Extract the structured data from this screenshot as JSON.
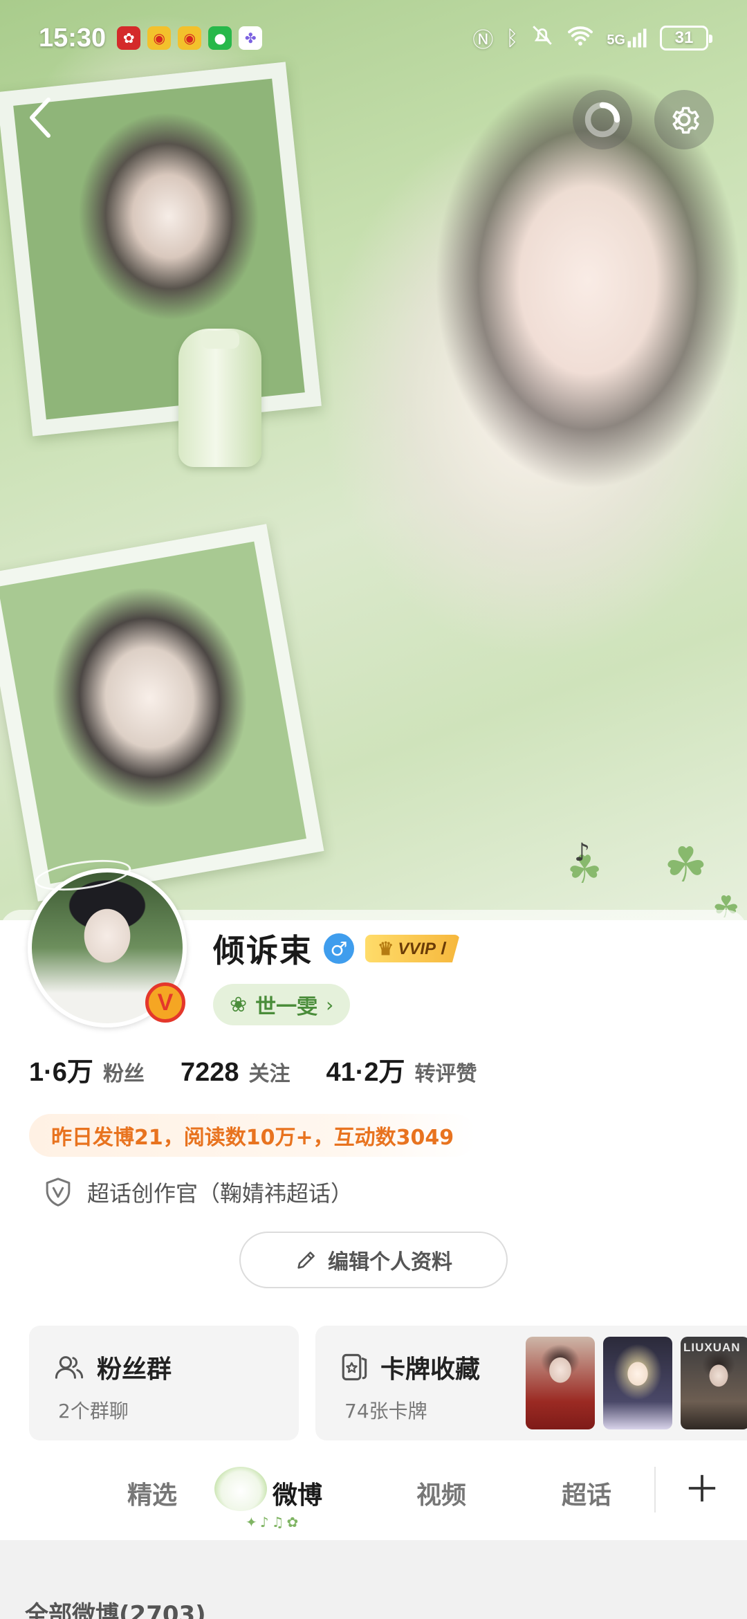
{
  "status_bar": {
    "time": "15:30",
    "network": "5G",
    "battery": "31",
    "notification_apps": [
      "huawei-app-icon",
      "weibo-icon",
      "weibo-icon",
      "wechat-icon",
      "gallery-icon"
    ],
    "system_icons": [
      "nfc-icon",
      "bluetooth-icon",
      "mute-icon",
      "wifi-icon",
      "signal-icon"
    ]
  },
  "profile": {
    "username": "倾诉束",
    "gender_symbol": "♂",
    "vip_label": "VVIP Ⅰ",
    "title_pill": "世一雯",
    "verified_badge": "V",
    "stats": [
      {
        "value": "1·6万",
        "label": "粉丝"
      },
      {
        "value": "7228",
        "label": "关注"
      },
      {
        "value": "41·2万",
        "label": "转评赞"
      }
    ],
    "highlight": "昨日发博21，阅读数10万+，互动数3049",
    "creator_role": "超话创作官（鞠婧祎超话）",
    "edit_button": "编辑个人资料"
  },
  "cards": {
    "fans_group": {
      "title": "粉丝群",
      "subtitle": "2个群聊"
    },
    "card_collection": {
      "title": "卡牌收藏",
      "subtitle": "74张卡牌",
      "thumb_text": "LIUXUAN"
    }
  },
  "tabs": [
    {
      "label": "精选"
    },
    {
      "label": "微博"
    },
    {
      "label": "视频"
    },
    {
      "label": "超话"
    }
  ],
  "active_tab": "微博",
  "feed": {
    "count_label": "全部微博(2703)"
  },
  "colors": {
    "accent_orange": "#e8731f",
    "title_green": "#4a8d3a",
    "gender_blue": "#3f9ded",
    "vip_gold": "#f6b73c"
  }
}
